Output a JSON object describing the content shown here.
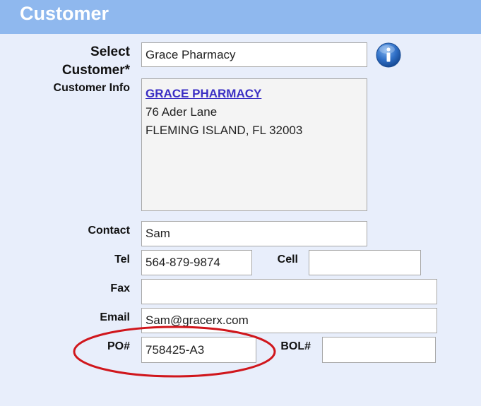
{
  "header": {
    "title": "Customer"
  },
  "labels": {
    "select_customer_line1": "Select",
    "select_customer_line2": "Customer*",
    "customer_info": "Customer Info",
    "contact": "Contact",
    "tel": "Tel",
    "cell": "Cell",
    "fax": "Fax",
    "email": "Email",
    "po": "PO#",
    "bol": "BOL#"
  },
  "fields": {
    "customer": "Grace Pharmacy",
    "contact": "Sam",
    "tel": "564-879-9874",
    "cell": "",
    "fax": "",
    "email": "Sam@gracerx.com",
    "po": "758425-A3",
    "bol": ""
  },
  "customer_info": {
    "name": "GRACE PHARMACY",
    "address1": "76 Ader Lane",
    "address2": "FLEMING ISLAND, FL 32003"
  },
  "icons": {
    "info": "info-icon"
  },
  "colors": {
    "header": "#8fb8ee",
    "background": "#e8eefb",
    "link": "#3b2fc4",
    "annotation": "#d0161c"
  }
}
